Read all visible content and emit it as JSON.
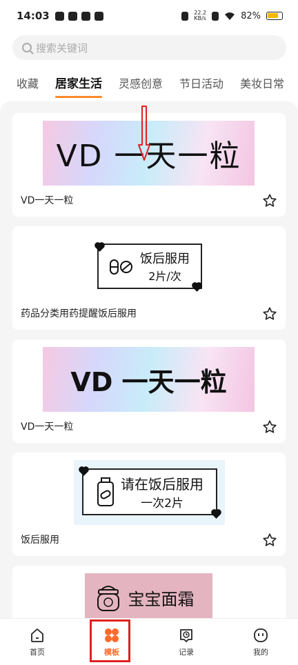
{
  "status_bar": {
    "time": "14:03",
    "net_speed_top": "22.2",
    "net_speed_bottom": "KB/s",
    "battery": "82%"
  },
  "search": {
    "placeholder": "搜索关键词"
  },
  "tabs": [
    {
      "label": "收藏"
    },
    {
      "label": "居家生活"
    },
    {
      "label": "灵感创意"
    },
    {
      "label": "节日活动"
    },
    {
      "label": "美妆日常"
    }
  ],
  "templates": [
    {
      "label": "VD一天一粒",
      "image_text": "VD 一天一粒"
    },
    {
      "label": "药品分类用药提醒饭后服用",
      "image_line1": "饭后服用",
      "image_line2": "2片/次"
    },
    {
      "label": "VD一天一粒",
      "image_text": "VD 一天一粒"
    },
    {
      "label": "饭后服用",
      "image_line1": "请在饭后服用",
      "image_line2": "一次2片"
    },
    {
      "image_text": "宝宝面霜"
    }
  ],
  "bottom_nav": [
    {
      "label": "首页",
      "icon": "home-icon"
    },
    {
      "label": "模板",
      "icon": "template-icon"
    },
    {
      "label": "记录",
      "icon": "record-icon"
    },
    {
      "label": "我的",
      "icon": "profile-icon"
    }
  ],
  "colors": {
    "accent": "#ff6a2b",
    "tab_indicator": "#ff8a2b",
    "highlight": "#e02020",
    "arrow": "#e02020"
  }
}
